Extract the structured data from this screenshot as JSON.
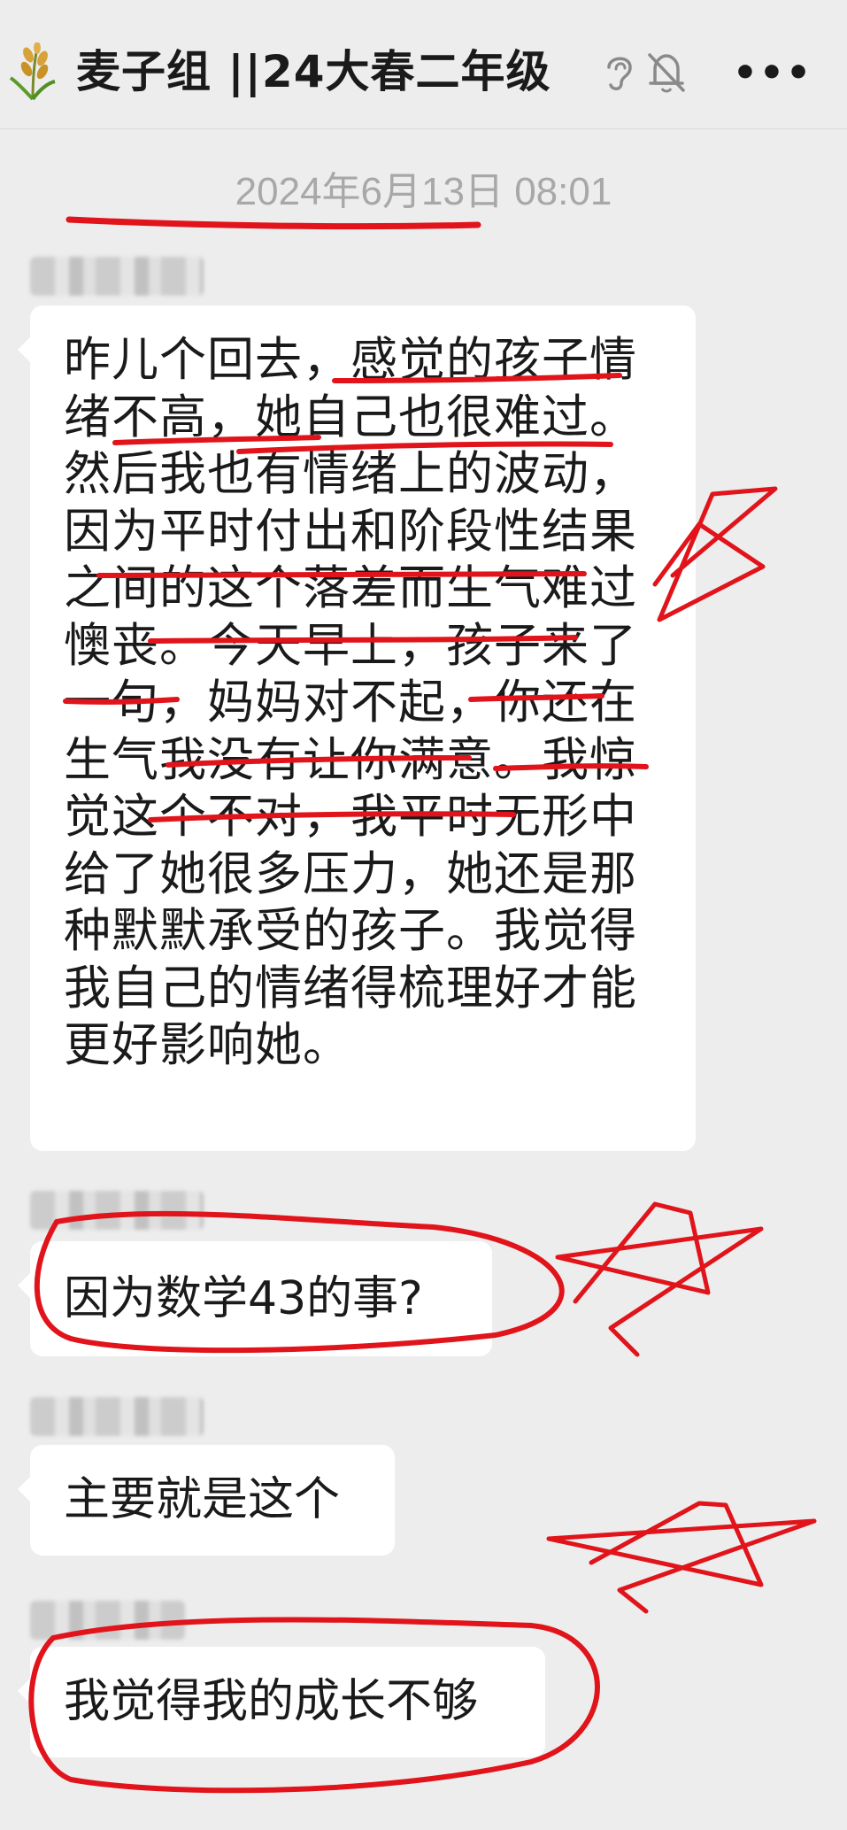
{
  "header": {
    "chat_title": "麦子组 ||24大春二年级",
    "more_label": "•••",
    "icons": [
      "wheat-group-avatar-icon",
      "ear-icon",
      "bell-off-icon",
      "more-icon"
    ]
  },
  "timestamp": "2024年6月13日 08:01",
  "messages": [
    {
      "sender_blurred": true,
      "lines": [
        "昨儿个回去，感觉的孩子情",
        "绪不高，她自己也很难过。",
        "然后我也有情绪上的波动，",
        "因为平时付出和阶段性结果",
        "之间的这个落差而生气难过",
        "懊丧。今天早上，孩子来了",
        "一句，妈妈对不起，你还在",
        "生气我没有让你满意。我惊",
        "觉这个不对，我平时无形中",
        "给了她很多压力，她还是那",
        "种默默承受的孩子。我觉得",
        "我自己的情绪得梳理好才能",
        "更好影响她。"
      ]
    },
    {
      "sender_blurred": true,
      "text": "因为数学43的事?"
    },
    {
      "sender_blurred": true,
      "text": "主要就是这个"
    },
    {
      "sender_blurred": true,
      "text": "我觉得我的成长不够"
    }
  ],
  "colors": {
    "background": "#ededed",
    "bubble": "#ffffff",
    "text": "#1a1a1a",
    "timestamp": "#a8a8a8",
    "annotation": "#e0141a"
  }
}
